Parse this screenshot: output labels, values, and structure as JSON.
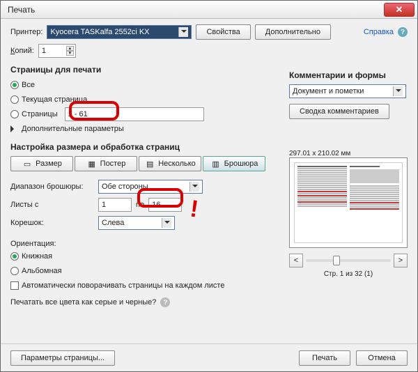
{
  "title": "Печать",
  "printer": {
    "label": "Принтер:",
    "value": "Kyocera TASKalfa 2552ci KX",
    "properties": "Свойства",
    "advanced": "Дополнительно"
  },
  "help_link": "Справка",
  "copies": {
    "label": "Копий:",
    "value": "1"
  },
  "pages": {
    "section": "Страницы для печати",
    "all": "Все",
    "current": "Текущая страница",
    "range_label": "Страницы",
    "range_value": "1 - 61",
    "more": "Дополнительные параметры"
  },
  "sizing": {
    "section": "Настройка размера и обработка страниц",
    "size": "Размер",
    "poster": "Постер",
    "multiple": "Несколько",
    "booklet": "Брошюра"
  },
  "booklet": {
    "range_label": "Диапазон брошюры:",
    "range_value": "Обе стороны",
    "sheets_from": "Листы с",
    "from_value": "1",
    "to_label": "по",
    "to_value": "16",
    "binding_label": "Корешок:",
    "binding_value": "Слева"
  },
  "orientation": {
    "label": "Ориентация:",
    "portrait": "Книжная",
    "landscape": "Альбомная",
    "auto": "Автоматически поворачивать страницы на каждом листе"
  },
  "grayscale": "Печатать все цвета как серые и черные?",
  "comments": {
    "section": "Комментарии и формы",
    "value": "Документ и пометки",
    "summary": "Сводка комментариев"
  },
  "preview_dim": "297.01 x 210.02 мм",
  "preview_nav": {
    "left": "<",
    "right": ">",
    "status": "Стр. 1 из 32 (1)"
  },
  "footer": {
    "page_setup": "Параметры страницы...",
    "print": "Печать",
    "cancel": "Отмена"
  }
}
